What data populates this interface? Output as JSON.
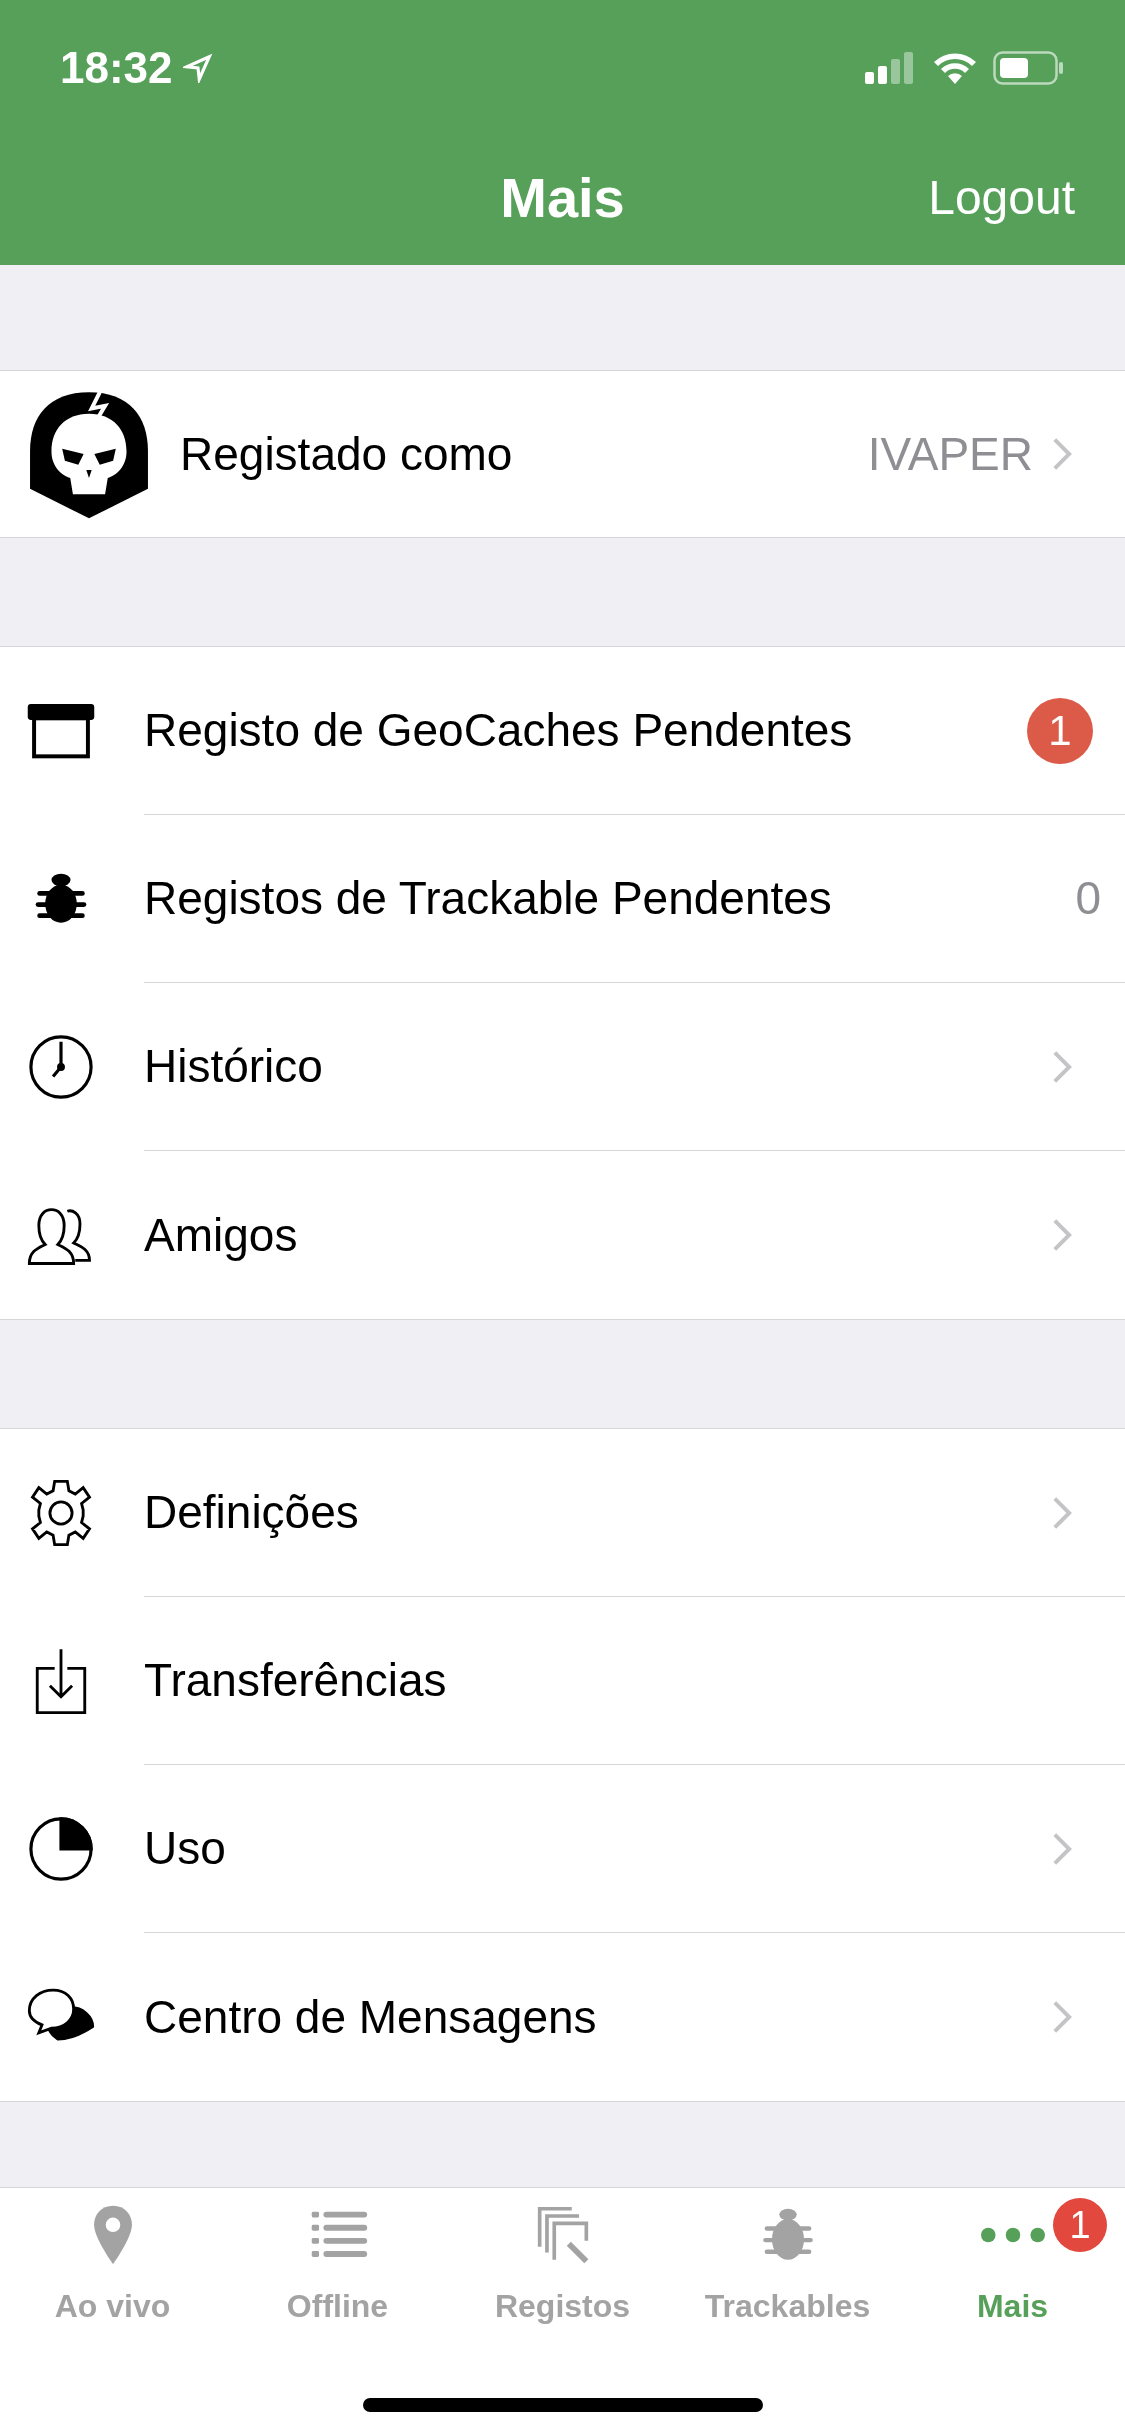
{
  "status_bar": {
    "time": "18:32"
  },
  "nav": {
    "title": "Mais",
    "action": "Logout"
  },
  "account": {
    "label": "Registado como",
    "value": "IVAPER"
  },
  "sections": [
    {
      "items": [
        {
          "label": "Registo de GeoCaches Pendentes",
          "accessory": {
            "kind": "badge",
            "text": "1"
          }
        },
        {
          "label": "Registos de Trackable Pendentes",
          "accessory": {
            "kind": "count",
            "text": "0"
          }
        },
        {
          "label": "Histórico",
          "accessory": {
            "kind": "chevron"
          }
        },
        {
          "label": "Amigos",
          "accessory": {
            "kind": "chevron"
          }
        }
      ]
    },
    {
      "items": [
        {
          "label": "Definições",
          "accessory": {
            "kind": "chevron"
          }
        },
        {
          "label": "Transferências",
          "accessory": {
            "kind": "none"
          }
        },
        {
          "label": "Uso",
          "accessory": {
            "kind": "chevron"
          }
        },
        {
          "label": "Centro de Mensagens",
          "accessory": {
            "kind": "chevron"
          }
        }
      ]
    }
  ],
  "tabs": [
    {
      "label": "Ao vivo",
      "selected": false
    },
    {
      "label": "Offline",
      "selected": false
    },
    {
      "label": "Registos",
      "selected": false
    },
    {
      "label": "Trackables",
      "selected": false
    },
    {
      "label": "Mais",
      "selected": true,
      "badge": "1"
    }
  ]
}
